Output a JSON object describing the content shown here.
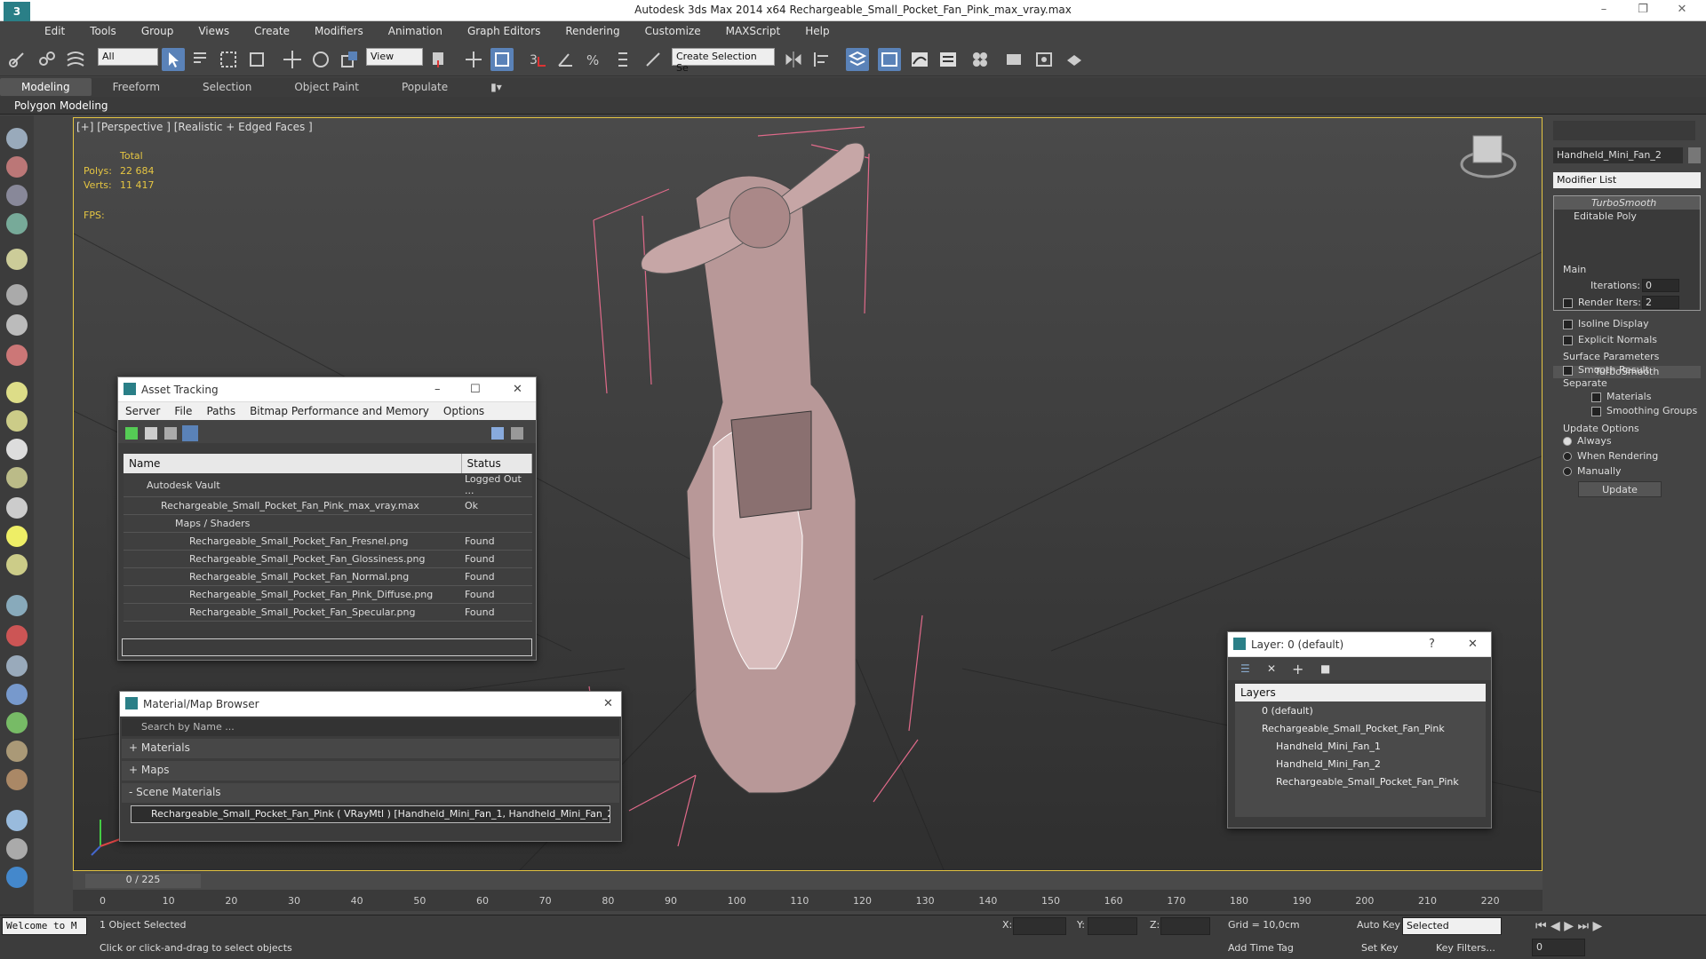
{
  "window": {
    "title": "Autodesk 3ds Max  2014 x64      Rechargeable_Small_Pocket_Fan_Pink_max_vray.max",
    "logo": "3"
  },
  "menu": [
    "Edit",
    "Tools",
    "Group",
    "Views",
    "Create",
    "Modifiers",
    "Animation",
    "Graph Editors",
    "Rendering",
    "Customize",
    "MAXScript",
    "Help"
  ],
  "toolbar": {
    "filter": "All",
    "ref_coord": "View",
    "selection_set": "Create Selection Se"
  },
  "ribbon": {
    "tabs": [
      "Modeling",
      "Freeform",
      "Selection",
      "Object Paint",
      "Populate"
    ],
    "sub": "Polygon Modeling"
  },
  "viewport": {
    "label": "[+] [Perspective ] [Realistic + Edged Faces ]",
    "total": "Total",
    "polys_label": "Polys:",
    "polys": "22 684",
    "verts_label": "Verts:",
    "verts": "11 417",
    "fps_label": "FPS:"
  },
  "asset_tracking": {
    "title": "Asset Tracking",
    "menu": [
      "Server",
      "File",
      "Paths",
      "Bitmap Performance and Memory",
      "Options"
    ],
    "col_name": "Name",
    "col_status": "Status",
    "rows": [
      {
        "name": "Autodesk Vault",
        "status": "Logged Out ..."
      },
      {
        "name": "Rechargeable_Small_Pocket_Fan_Pink_max_vray.max",
        "status": "Ok"
      },
      {
        "name": "Maps / Shaders",
        "status": ""
      },
      {
        "name": "Rechargeable_Small_Pocket_Fan_Fresnel.png",
        "status": "Found"
      },
      {
        "name": "Rechargeable_Small_Pocket_Fan_Glossiness.png",
        "status": "Found"
      },
      {
        "name": "Rechargeable_Small_Pocket_Fan_Normal.png",
        "status": "Found"
      },
      {
        "name": "Rechargeable_Small_Pocket_Fan_Pink_Diffuse.png",
        "status": "Found"
      },
      {
        "name": "Rechargeable_Small_Pocket_Fan_Specular.png",
        "status": "Found"
      }
    ]
  },
  "material_browser": {
    "title": "Material/Map Browser",
    "search_placeholder": "Search by Name ...",
    "groups": [
      "+ Materials",
      "+ Maps",
      "- Scene Materials"
    ],
    "scene_material": "Rechargeable_Small_Pocket_Fan_Pink  ( VRayMtl )  [Handheld_Mini_Fan_1, Handheld_Mini_Fan_2]"
  },
  "layers": {
    "title": "Layer: 0 (default)",
    "header": "Layers",
    "items": [
      "0 (default)",
      "Rechargeable_Small_Pocket_Fan_Pink",
      "Handheld_Mini_Fan_1",
      "Handheld_Mini_Fan_2",
      "Rechargeable_Small_Pocket_Fan_Pink"
    ]
  },
  "command_panel": {
    "object_name": "Handheld_Mini_Fan_2",
    "modifier_list": "Modifier List",
    "stack": [
      "TurboSmooth",
      "Editable Poly"
    ],
    "rollout": "TurboSmooth",
    "main": "Main",
    "iterations_label": "Iterations:",
    "iterations": "0",
    "render_iters_label": "Render Iters:",
    "render_iters": "2",
    "isoline": "Isoline Display",
    "explicit": "Explicit Normals",
    "surface": "Surface Parameters",
    "smooth": "Smooth Result",
    "separate": "Separate",
    "materials": "Materials",
    "smoothing": "Smoothing Groups",
    "update_opts": "Update Options",
    "always": "Always",
    "when_rendering": "When Rendering",
    "manually": "Manually",
    "update_btn": "Update"
  },
  "timeline": {
    "frame": "0 / 225",
    "ticks": [
      "0",
      "10",
      "20",
      "30",
      "40",
      "50",
      "60",
      "70",
      "80",
      "90",
      "100",
      "110",
      "120",
      "130",
      "140",
      "150",
      "160",
      "170",
      "180",
      "190",
      "200",
      "210",
      "220"
    ]
  },
  "status": {
    "welcome": "Welcome to M",
    "selected": "1 Object Selected",
    "prompt": "Click or click-and-drag to select objects",
    "x": "X:",
    "y": "Y:",
    "z": "Z:",
    "grid": "Grid = 10,0cm",
    "add_time_tag": "Add Time Tag",
    "auto_key": "Auto Key",
    "set_key": "Set Key",
    "selected_combo": "Selected",
    "key_filters": "Key Filters...",
    "frame_field": "0"
  }
}
